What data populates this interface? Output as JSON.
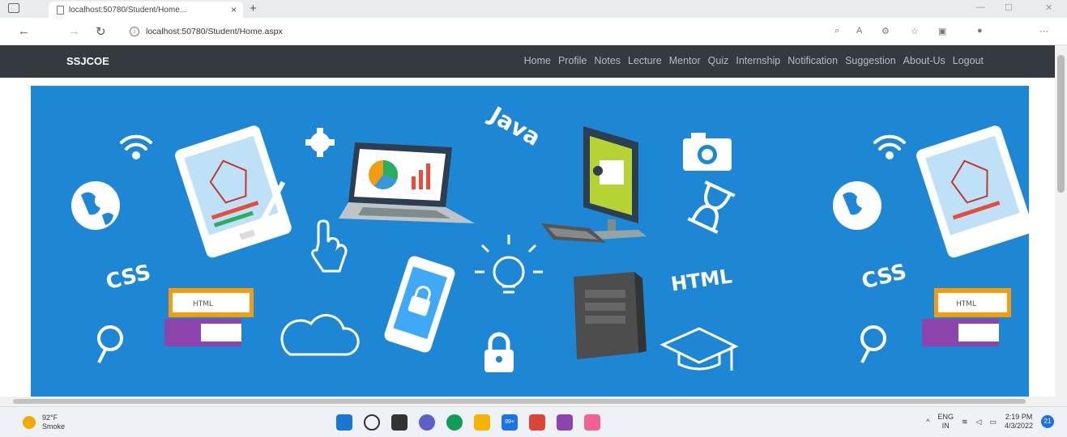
{
  "browser": {
    "tab_title": "localhost:50780/Student/Home...",
    "tab_close": "×",
    "new_tab": "+",
    "url": "localhost:50780/Student/Home.aspx"
  },
  "site": {
    "brand": "SSJCOE",
    "menu": [
      "Home",
      "Profile",
      "Notes",
      "Lecture",
      "Mentor",
      "Quiz",
      "Internship",
      "Notification",
      "Suggestion",
      "About-Us",
      "Logout"
    ]
  },
  "banner": {
    "labels": {
      "java": "Java",
      "css_left": "CSS",
      "html": "HTML",
      "css_right": "CSS",
      "book_left": "HTML",
      "book_right": "HTML"
    },
    "background_color": "#1e87d5"
  },
  "taskbar": {
    "temperature": "92°F",
    "weather": "Smoke",
    "lang": "ENG",
    "region": "IN",
    "time": "2:19 PM",
    "date": "4/3/2022",
    "notifications": "21",
    "mail_badge": "99+"
  },
  "icons": [
    "sidebar-icon",
    "back-icon",
    "forward-icon",
    "refresh-icon",
    "info-icon",
    "read-aloud-icon",
    "favorites-icon",
    "collections-icon",
    "profile-icon",
    "more-icon"
  ]
}
